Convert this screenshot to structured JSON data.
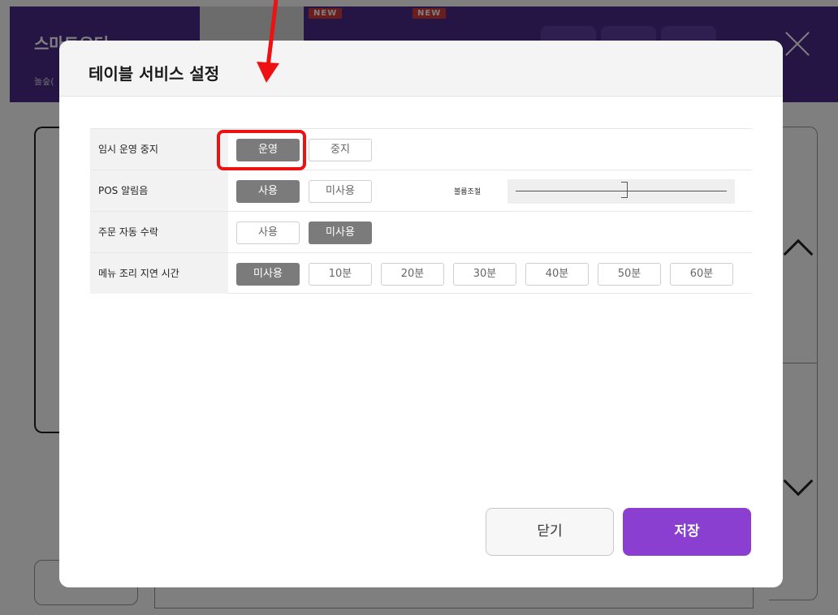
{
  "app": {
    "title": "스마트오더",
    "subtitle": "놀숲(",
    "badges": [
      "NEW",
      "NEW"
    ]
  },
  "modal": {
    "title": "테이블 서비스 설정",
    "rows": [
      {
        "label": "임시 운영 중지",
        "options": [
          "운영",
          "중지"
        ],
        "selected": "운영"
      },
      {
        "label": "POS 알림음",
        "options": [
          "사용",
          "미사용"
        ],
        "selected": "사용",
        "volume": {
          "label": "볼륨조절",
          "level": 0.5
        }
      },
      {
        "label": "주문 자동 수락",
        "options": [
          "사용",
          "미사용"
        ],
        "selected": "미사용"
      },
      {
        "label": "메뉴 조리 지연 시간",
        "options": [
          "미사용",
          "10분",
          "20분",
          "30분",
          "40분",
          "50분",
          "60분"
        ],
        "selected": "미사용"
      }
    ],
    "buttons": {
      "close": "닫기",
      "save": "저장"
    }
  },
  "colors": {
    "header_purple": "#4a2a8a",
    "save_purple": "#8a3fd1",
    "selected_gray": "#7b7b7b",
    "annotation_red": "#ee1111"
  }
}
